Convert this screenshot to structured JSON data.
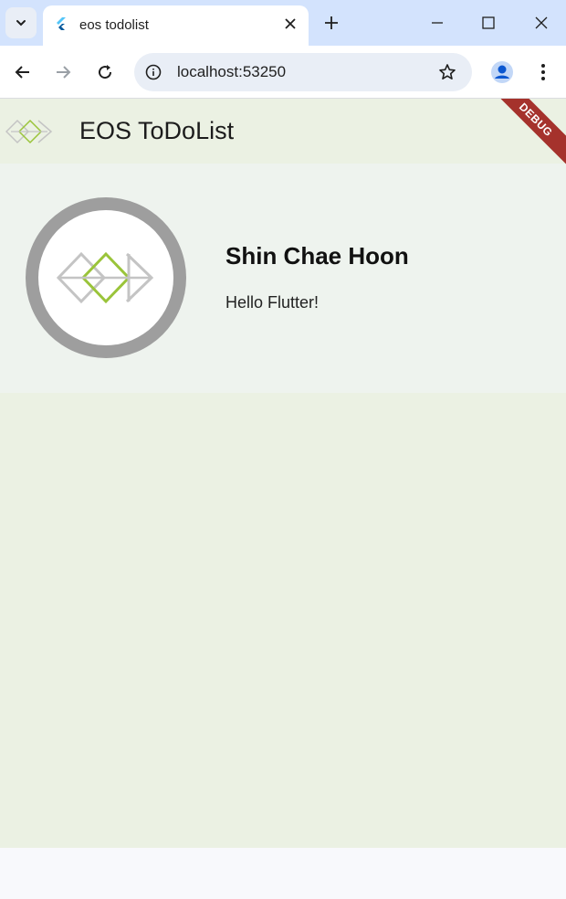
{
  "browser": {
    "tab": {
      "title": "eos todolist",
      "favicon": "flutter-icon"
    },
    "window_controls": [
      "minimize-icon",
      "maximize-icon",
      "close-icon"
    ],
    "toolbar": {
      "url": "localhost:53250"
    }
  },
  "app": {
    "appbar": {
      "title": "EOS ToDoList",
      "logo": "eos-logo-icon"
    },
    "profile": {
      "name": "Shin Chae Hoon",
      "bio": "Hello Flutter!"
    },
    "debug_banner": "DEBUG"
  },
  "colors": {
    "app_background": "#ebf1e3",
    "card_background": "#eef3ee",
    "avatar_ring": "#9e9e9e",
    "logo_accent": "#9ac43a",
    "logo_gray": "#c4c4c4",
    "debug_banner": "#a5322c",
    "tabstrip": "#d3e3fd"
  }
}
